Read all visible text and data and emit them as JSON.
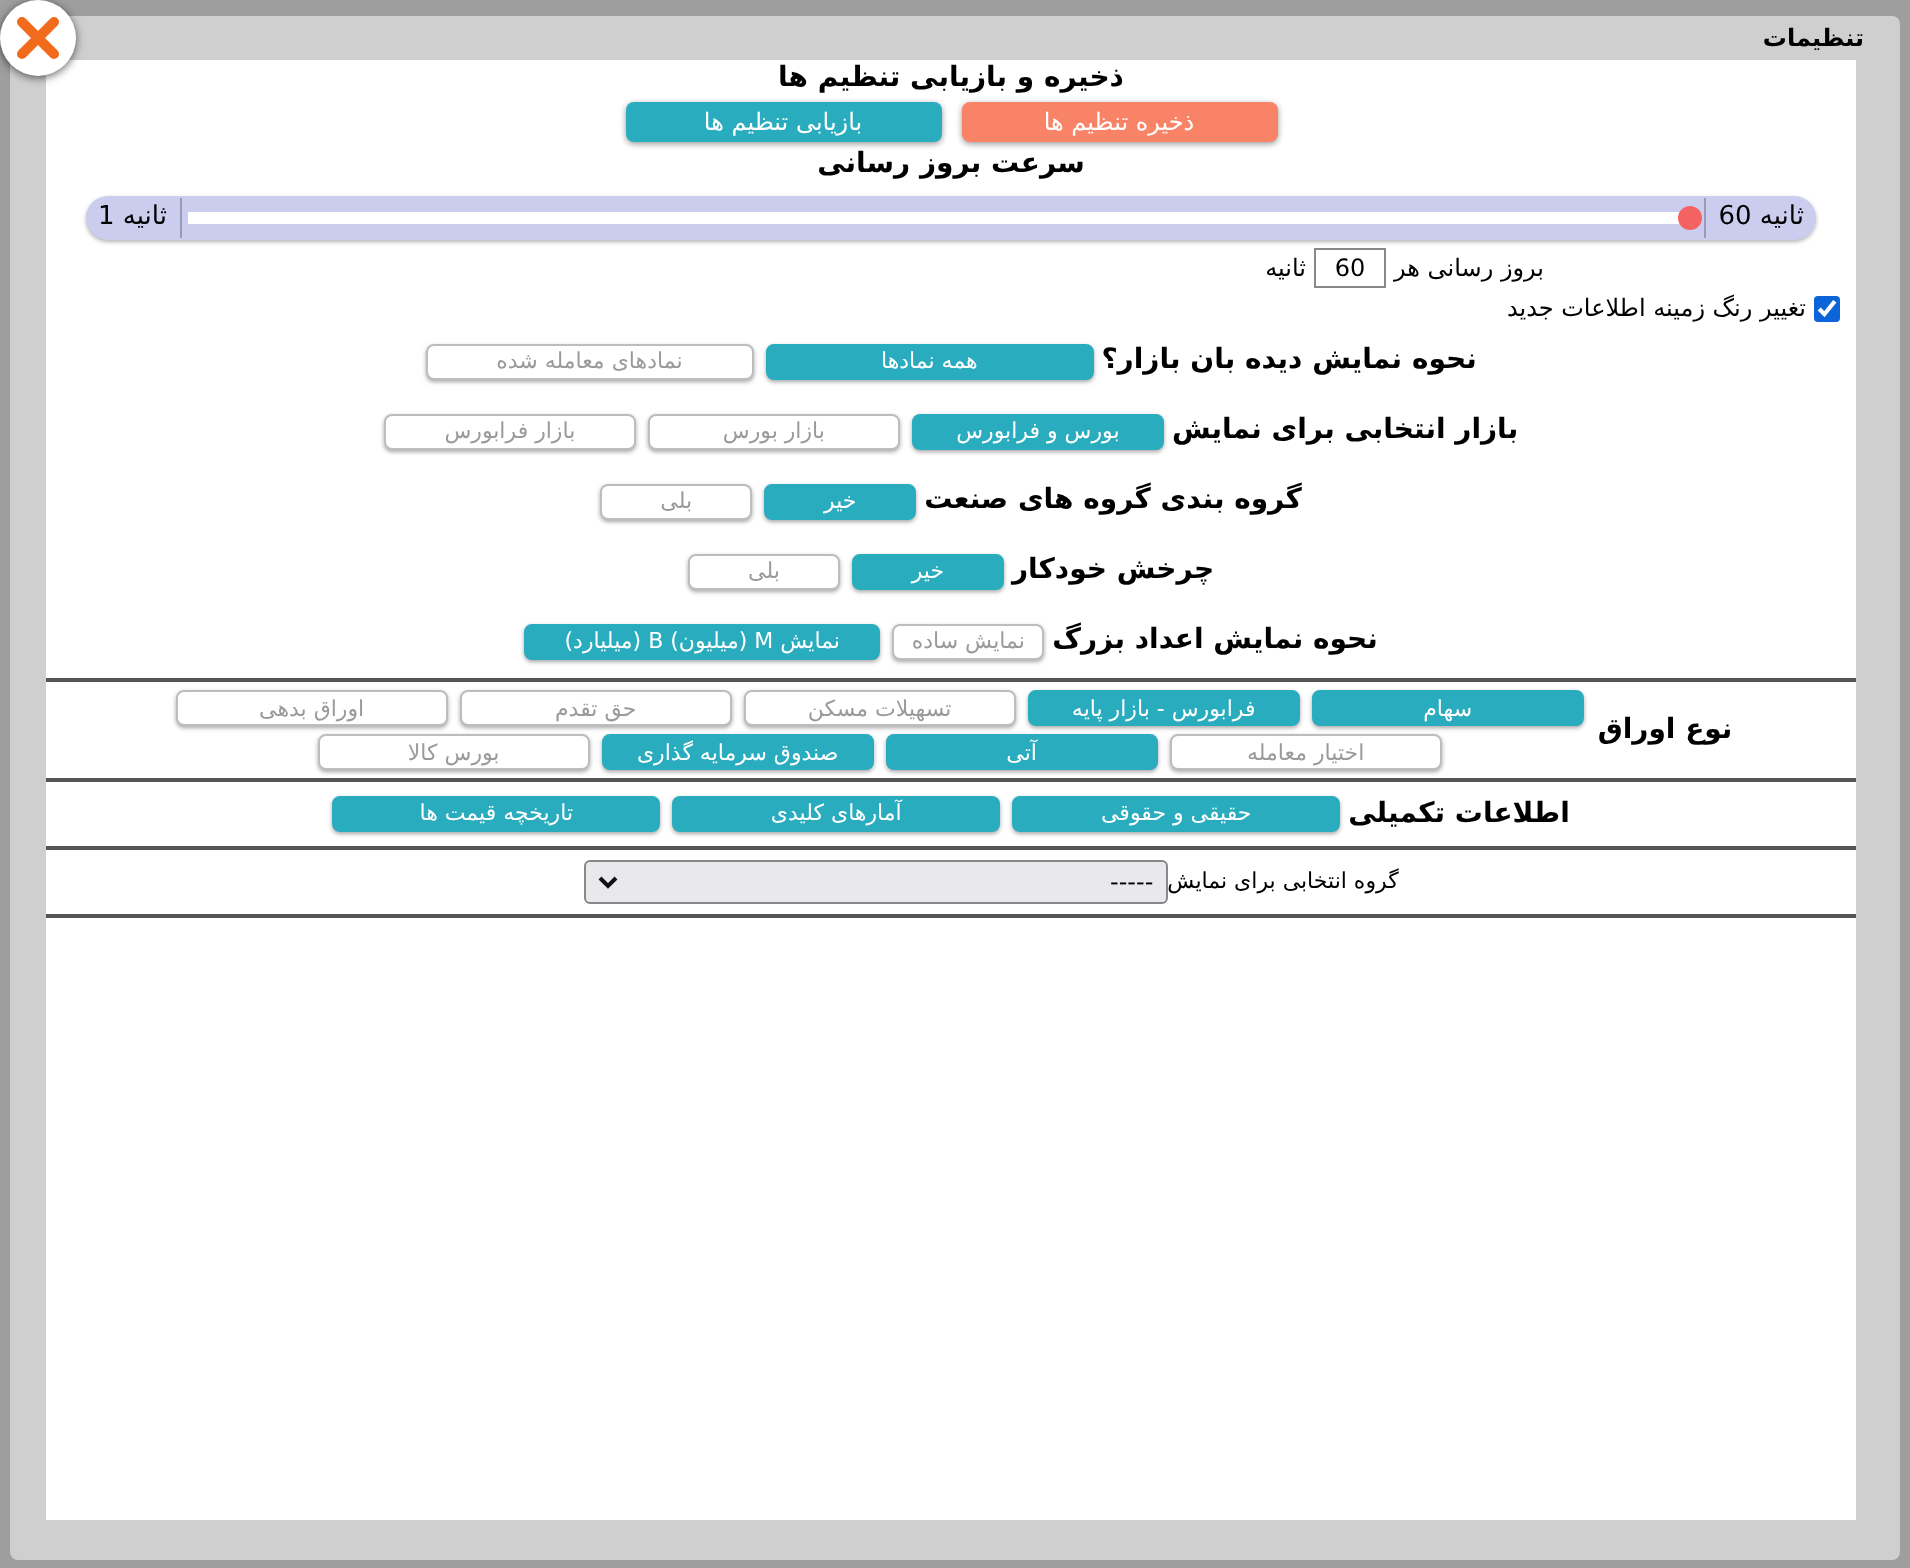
{
  "dialog": {
    "title": "تنظیمات"
  },
  "save_restore": {
    "heading": "ذخیره و بازیابی تنظیم ها",
    "buttons": [
      {
        "label": "ذخیره تنظیم ها",
        "kind": "save"
      },
      {
        "label": "بازیابی تنظیم ها",
        "kind": "restore"
      }
    ]
  },
  "refresh_speed": {
    "heading": "سرعت بروز رسانی",
    "max_label": "ثانیه 60",
    "min_label": "ثانیه 1",
    "level": 1
  },
  "refresh_interval": {
    "prefix": "بروز رسانی هر",
    "value": "60",
    "suffix": "ثانیه"
  },
  "highlight_new": {
    "label": "تغییر رنگ زمینه اطلاعات جدید",
    "checked": true
  },
  "option_groups": [
    {
      "label": "نحوه نمایش دیده بان بازار؟",
      "options": [
        {
          "label": "همه نمادها",
          "selected": true
        },
        {
          "label": "نمادهای معامله شده",
          "selected": false
        }
      ]
    },
    {
      "label": "بازار انتخابی برای نمایش",
      "options": [
        {
          "label": "بورس و فرابورس",
          "selected": true
        },
        {
          "label": "بازار بورس",
          "selected": false
        },
        {
          "label": "بازار فرابورس",
          "selected": false
        }
      ]
    },
    {
      "label": "گروه بندی گروه های صنعت",
      "options": [
        {
          "label": "خیر",
          "selected": true
        },
        {
          "label": "بلی",
          "selected": false
        }
      ]
    },
    {
      "label": "چرخش خودکار",
      "options": [
        {
          "label": "خیر",
          "selected": true
        },
        {
          "label": "بلی",
          "selected": false
        }
      ]
    },
    {
      "label": "نحوه نمایش اعداد بزرگ",
      "options": [
        {
          "label": "نمایش ساده",
          "selected": false
        },
        {
          "label": "نمایش M (میلیون) B (میلیارد)",
          "selected": true
        }
      ]
    }
  ],
  "security_types": {
    "label": "نوع اوراق",
    "options": [
      {
        "label": "سهام",
        "selected": true
      },
      {
        "label": "فرابورس - بازار پایه",
        "selected": true
      },
      {
        "label": "تسهیلات مسکن",
        "selected": false
      },
      {
        "label": "حق تقدم",
        "selected": false
      },
      {
        "label": "اوراق بدهی",
        "selected": false
      },
      {
        "label": "اختیار معامله",
        "selected": false
      },
      {
        "label": "آتی",
        "selected": true
      },
      {
        "label": "صندوق سرمایه گذاری",
        "selected": true
      },
      {
        "label": "بورس کالا",
        "selected": false
      }
    ]
  },
  "extra_info": {
    "label": "اطلاعات تکمیلی",
    "buttons": [
      "حقیقی و حقوقی",
      "آمارهای کلیدی",
      "تاریخچه قیمت ها"
    ]
  },
  "group_select": {
    "label": "گروه انتخابی برای نمایش",
    "value": "-----"
  }
}
